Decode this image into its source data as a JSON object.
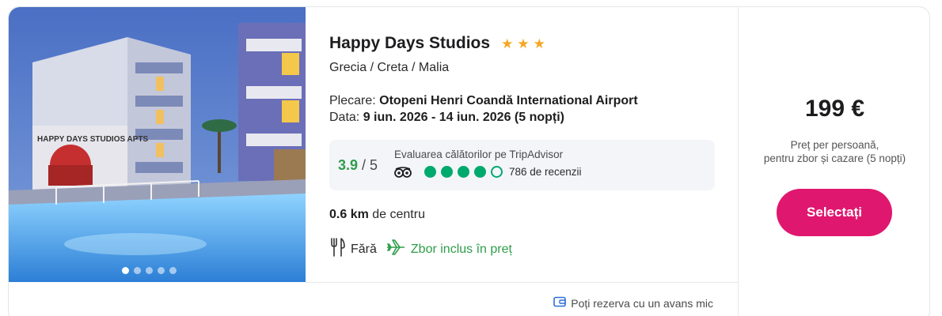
{
  "hotel": {
    "name": "Happy Days Studios",
    "stars": 3,
    "location": "Grecia / Creta / Malia",
    "departure_label": "Plecare:",
    "departure_value": "Otopeni Henri Coandă International Airport",
    "date_label": "Data:",
    "date_value": "9 iun. 2026 - 14 iun. 2026 (5 nopți)"
  },
  "photo": {
    "sign_text": "HAPPY DAYS STUDIOS APTS",
    "slide_count": 5,
    "active_slide": 1
  },
  "rating": {
    "score": "3.9",
    "max": "/ 5",
    "label": "Evaluarea călătorilor pe TripAdvisor",
    "bubbles_filled": 4,
    "bubbles_total": 5,
    "reviews": "786 de recenzii",
    "bubble_color": "#00aa6c",
    "score_color": "#2e9d4a"
  },
  "distance": {
    "value": "0.6 km",
    "suffix": "de centru"
  },
  "features": {
    "meal": "Fără",
    "flight": "Zbor inclus în preț"
  },
  "deposit": {
    "text": "Poți rezerva cu un avans mic"
  },
  "price": {
    "value": "199 €",
    "note_line1": "Preț per persoană,",
    "note_line2": "pentru zbor și cazare (5 nopți)",
    "select_label": "Selectați",
    "button_color": "#e0176e"
  }
}
